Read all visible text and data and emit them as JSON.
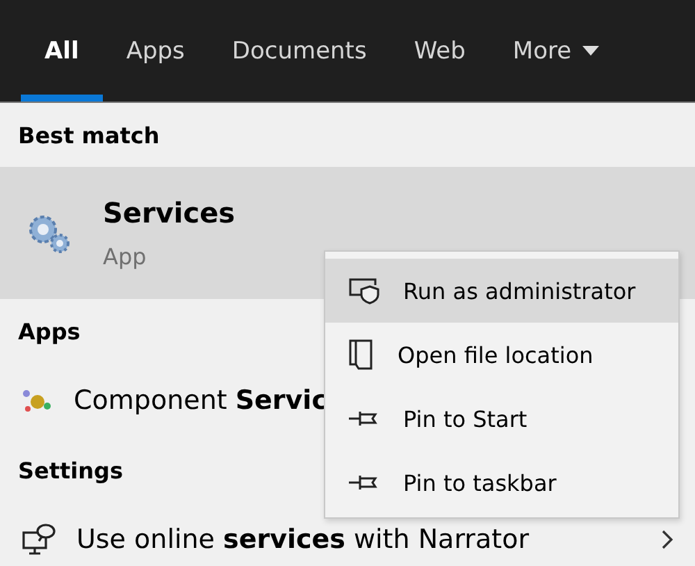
{
  "tabs": [
    {
      "label": "All",
      "selected": true,
      "dropdown": false
    },
    {
      "label": "Apps",
      "selected": false,
      "dropdown": false
    },
    {
      "label": "Documents",
      "selected": false,
      "dropdown": false
    },
    {
      "label": "Web",
      "selected": false,
      "dropdown": false
    },
    {
      "label": "More",
      "selected": false,
      "dropdown": true
    }
  ],
  "best_match": {
    "heading": "Best match",
    "name": "Services",
    "type": "App"
  },
  "sections": [
    {
      "heading": "Apps",
      "items": [
        {
          "text": "Component **Servic**",
          "chevron": false
        }
      ]
    },
    {
      "heading": "Settings",
      "items": [
        {
          "text": "Use online **services** with Narrator",
          "chevron": true
        }
      ]
    }
  ],
  "context_menu": [
    {
      "label": "Run as administrator",
      "selected": true
    },
    {
      "label": "Open file location",
      "selected": false
    },
    {
      "label": "Pin to Start",
      "selected": false
    },
    {
      "label": "Pin to taskbar",
      "selected": false
    }
  ]
}
